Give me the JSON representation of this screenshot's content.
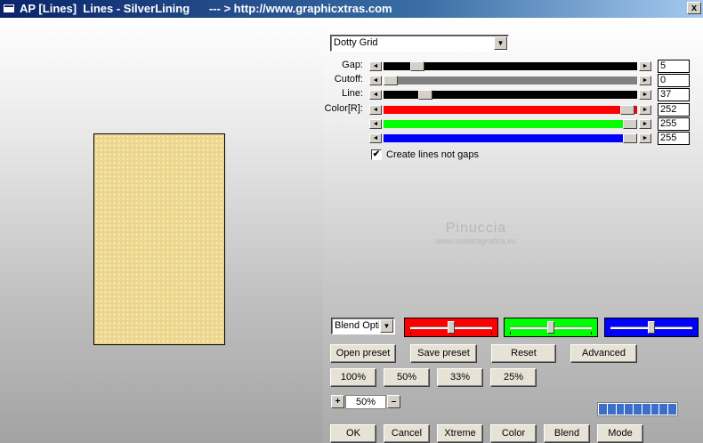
{
  "window": {
    "title": "AP [Lines]  Lines - SilverLining      --- > http://www.graphicxtras.com",
    "close_label": "x"
  },
  "preset_dropdown": {
    "value": "Dotty Grid",
    "arrow": "▼"
  },
  "sliders": [
    {
      "key": "gap",
      "label": "Gap:",
      "value": "5",
      "fraction": 0.11,
      "color": "#000000",
      "track_fill": "#000000"
    },
    {
      "key": "cutoff",
      "label": "Cutoff:",
      "value": "0",
      "fraction": 0.0,
      "color": "#808080",
      "track_fill": "#808080"
    },
    {
      "key": "line",
      "label": "Line:",
      "value": "37",
      "fraction": 0.145,
      "color": "#000000",
      "track_fill": "#000000"
    },
    {
      "key": "color_r",
      "label": "Color[R]:",
      "value": "252",
      "fraction": 0.988,
      "color": "#ff0000",
      "track_fill": "#ff0000"
    },
    {
      "key": "color_g",
      "label": "",
      "value": "255",
      "fraction": 1.0,
      "color": "#00ff00",
      "track_fill": "#00ff00"
    },
    {
      "key": "color_b",
      "label": "",
      "value": "255",
      "fraction": 1.0,
      "color": "#0000ff",
      "track_fill": "#0000ff"
    }
  ],
  "slider_arrows": {
    "left": "◄",
    "right": "►"
  },
  "checkbox": {
    "checked_mark": "✔",
    "label": "Create lines not gaps"
  },
  "watermark": {
    "line1": "Pinuccia",
    "line2": "www.maidiragrafica.eu"
  },
  "blend_dropdown": {
    "value": "Blend Optio",
    "arrow": "▼"
  },
  "color_sliders": [
    {
      "color": "#ff0000",
      "fraction": 0.5
    },
    {
      "color": "#00ff00",
      "fraction": 0.5
    },
    {
      "color": "#0000ff",
      "fraction": 0.5
    }
  ],
  "buttons": {
    "open_preset": "Open preset",
    "save_preset": "Save preset",
    "reset": "Reset",
    "advanced": "Advanced",
    "zoom_100": "100%",
    "zoom_50": "50%",
    "zoom_33": "33%",
    "zoom_25": "25%",
    "ok": "OK",
    "cancel": "Cancel",
    "xtreme": "Xtreme",
    "color": "Color",
    "blend": "Blend",
    "mode": "Mode"
  },
  "zoom": {
    "plus": "+",
    "minus": "–",
    "value": "50%"
  },
  "progress": {
    "segments": 9
  }
}
